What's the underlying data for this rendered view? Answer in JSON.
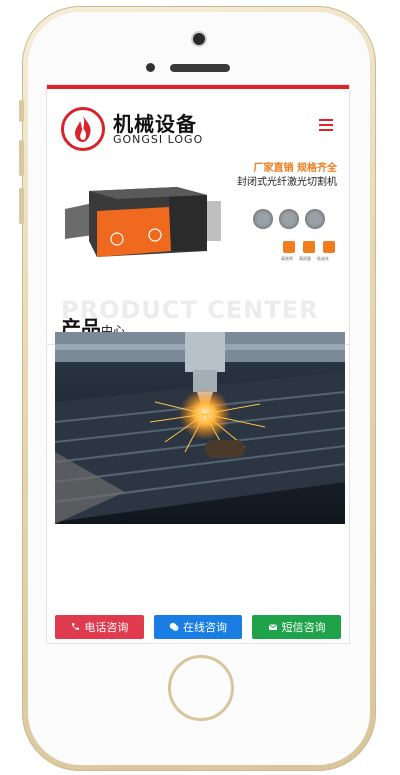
{
  "header": {
    "logo_title": "机械设备",
    "logo_subtitle": "GONGSI LOGO"
  },
  "banner": {
    "tagline_1": "厂家直销 规格齐全",
    "tagline_2": "封闭式光纤激光切割机",
    "feature_labels": [
      "高效率",
      "高质量",
      "低成本"
    ]
  },
  "section": {
    "bg_text": "PRODUCT CENTER",
    "title": "产品",
    "title_sub": "中心"
  },
  "actions": [
    {
      "label": "电话咨询",
      "color": "#e03a4e",
      "icon": "phone-icon"
    },
    {
      "label": "在线咨询",
      "color": "#1a7de3",
      "icon": "chat-icon"
    },
    {
      "label": "短信咨询",
      "color": "#1fa34a",
      "icon": "message-icon"
    }
  ],
  "colors": {
    "accent": "#e0222a",
    "orange": "#f07c1e"
  }
}
